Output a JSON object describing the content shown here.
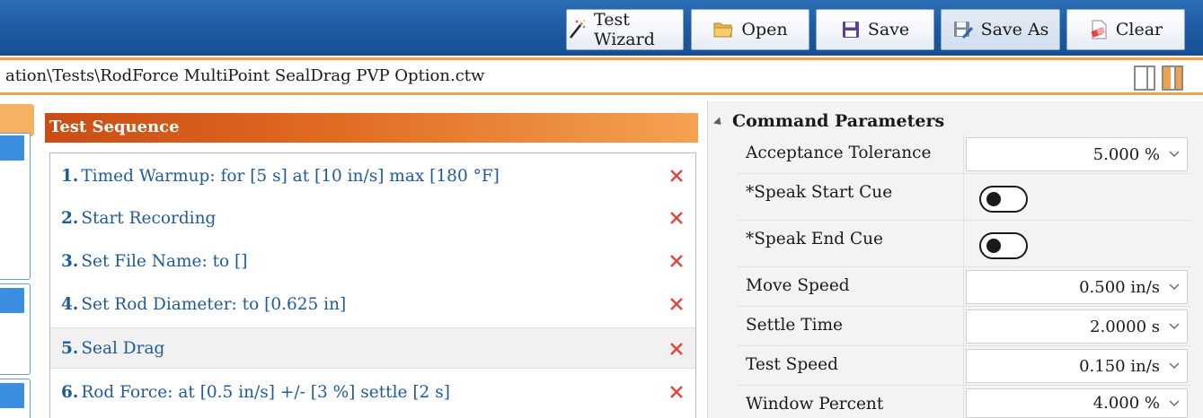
{
  "toolbar": {
    "buttons": [
      {
        "label": "Test Wizard",
        "icon": "wand-icon"
      },
      {
        "label": "Open",
        "icon": "folder-icon"
      },
      {
        "label": "Save",
        "icon": "floppy-icon"
      },
      {
        "label": "Save As",
        "icon": "floppy-edit-icon"
      },
      {
        "label": "Clear",
        "icon": "eraser-icon"
      }
    ]
  },
  "path": {
    "text": "ation\\Tests\\RodForce MultiPoint SealDrag PVP Option.ctw"
  },
  "sequence": {
    "title": "Test Sequence",
    "items": [
      {
        "num": "1.",
        "text": "Timed Warmup: for [5 s] at [10 in/s] max [180 °F]"
      },
      {
        "num": "2.",
        "text": "Start Recording"
      },
      {
        "num": "3.",
        "text": "Set File Name: to []"
      },
      {
        "num": "4.",
        "text": "Set Rod Diameter: to [0.625 in]"
      },
      {
        "num": "5.",
        "text": "Seal Drag"
      },
      {
        "num": "6.",
        "text": "Rod Force: at [0.5 in/s] +/- [3 %] settle [2 s]"
      }
    ],
    "selected_index": 4
  },
  "params": {
    "title": "Command Parameters",
    "rows": [
      {
        "label": "Acceptance Tolerance",
        "value": "5.000 %",
        "type": "select"
      },
      {
        "label": "*Speak Start Cue",
        "value": "",
        "type": "toggle",
        "on": false
      },
      {
        "label": "*Speak End Cue",
        "value": "",
        "type": "toggle",
        "on": false
      },
      {
        "label": "Move Speed",
        "value": "0.500 in/s",
        "type": "select"
      },
      {
        "label": "Settle Time",
        "value": "2.0000 s",
        "type": "select"
      },
      {
        "label": "Test Speed",
        "value": "0.150 in/s",
        "type": "select"
      },
      {
        "label": "Window Percent",
        "value": "4.000 %",
        "type": "select"
      }
    ]
  },
  "colors": {
    "toolbar_blue": "#1f5da4",
    "accent_orange": "#f0a24a",
    "header_orange": "#c94d14",
    "link_blue": "#1f5a99",
    "delete_red": "#e0453a"
  }
}
